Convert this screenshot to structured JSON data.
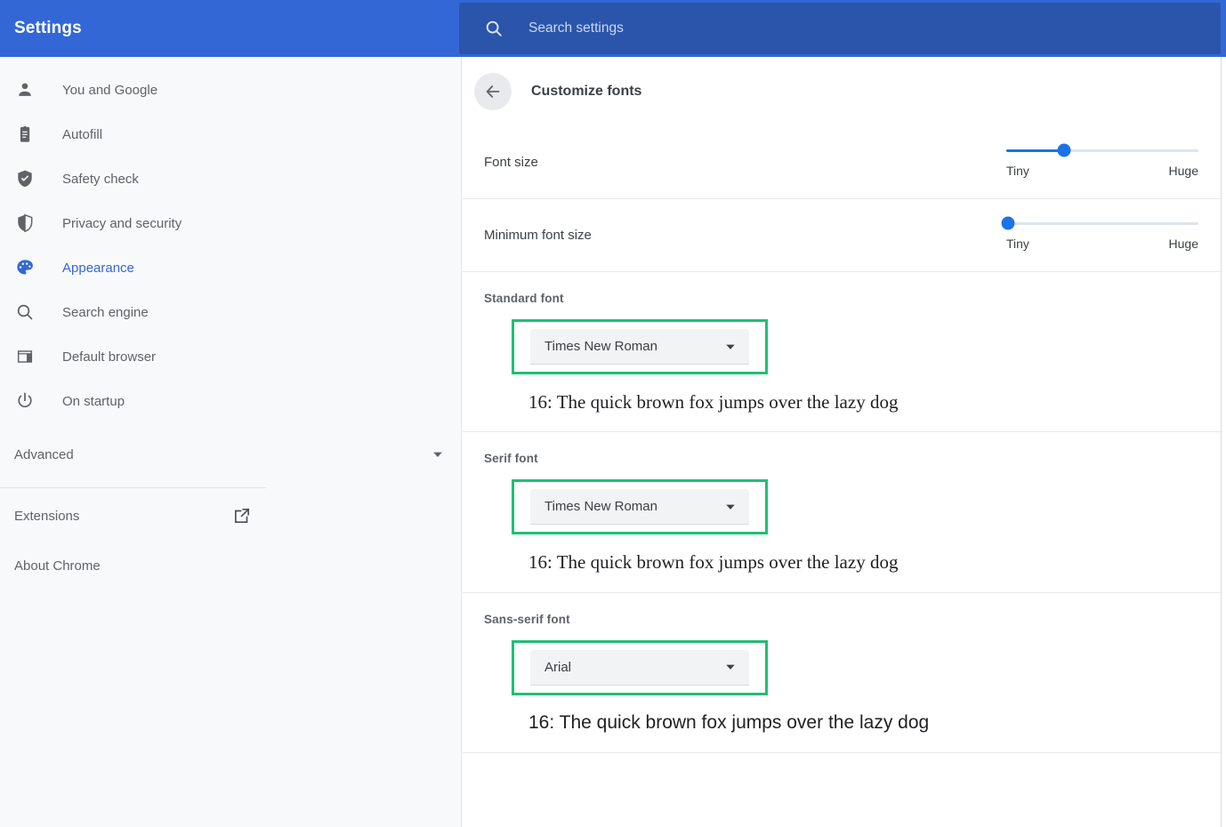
{
  "header": {
    "brand": "Settings",
    "search_icon": "search-icon",
    "search_placeholder": "Search settings",
    "search_value": "",
    "bg_color": "#3367d6",
    "search_bg_color": "#2a55ab"
  },
  "sidebar": {
    "items": [
      {
        "label": "You and Google",
        "icon": "person-icon",
        "active": false
      },
      {
        "label": "Autofill",
        "icon": "clipboard-icon",
        "active": false
      },
      {
        "label": "Safety check",
        "icon": "shield-check-icon",
        "active": false
      },
      {
        "label": "Privacy and security",
        "icon": "shield-icon",
        "active": false
      },
      {
        "label": "Appearance",
        "icon": "palette-icon",
        "active": true
      },
      {
        "label": "Search engine",
        "icon": "search-icon",
        "active": false
      },
      {
        "label": "Default browser",
        "icon": "browser-window-icon",
        "active": false
      },
      {
        "label": "On startup",
        "icon": "power-icon",
        "active": false
      }
    ],
    "advanced": {
      "label": "Advanced",
      "icon": "chevron-down-icon"
    },
    "bottom": [
      {
        "label": "Extensions",
        "icon": "external-link-icon"
      },
      {
        "label": "About Chrome",
        "icon": ""
      }
    ],
    "active_color": "#3367d6",
    "text_color": "#5f6368",
    "bg_color": "#f8f9fa"
  },
  "main": {
    "back_icon": "arrow-left-icon",
    "title": "Customize fonts",
    "sliders": [
      {
        "label": "Font size",
        "min_label": "Tiny",
        "max_label": "Huge",
        "value_percent": 30
      },
      {
        "label": "Minimum font size",
        "min_label": "Tiny",
        "max_label": "Huge",
        "value_percent": 0
      }
    ],
    "font_sections": [
      {
        "label": "Standard font",
        "selected": "Times New Roman",
        "arrow_icon": "chevron-down-icon",
        "sample": "16: The quick brown fox jumps over the lazy dog",
        "sample_style": "serif"
      },
      {
        "label": "Serif font",
        "selected": "Times New Roman",
        "arrow_icon": "chevron-down-icon",
        "sample": "16: The quick brown fox jumps over the lazy dog",
        "sample_style": "serif"
      },
      {
        "label": "Sans-serif font",
        "selected": "Arial",
        "arrow_icon": "chevron-down-icon",
        "sample": "16: The quick brown fox jumps over the lazy dog",
        "sample_style": "sans"
      }
    ],
    "highlight_color": "#1fbf75",
    "slider_color": "#1a73e8"
  }
}
